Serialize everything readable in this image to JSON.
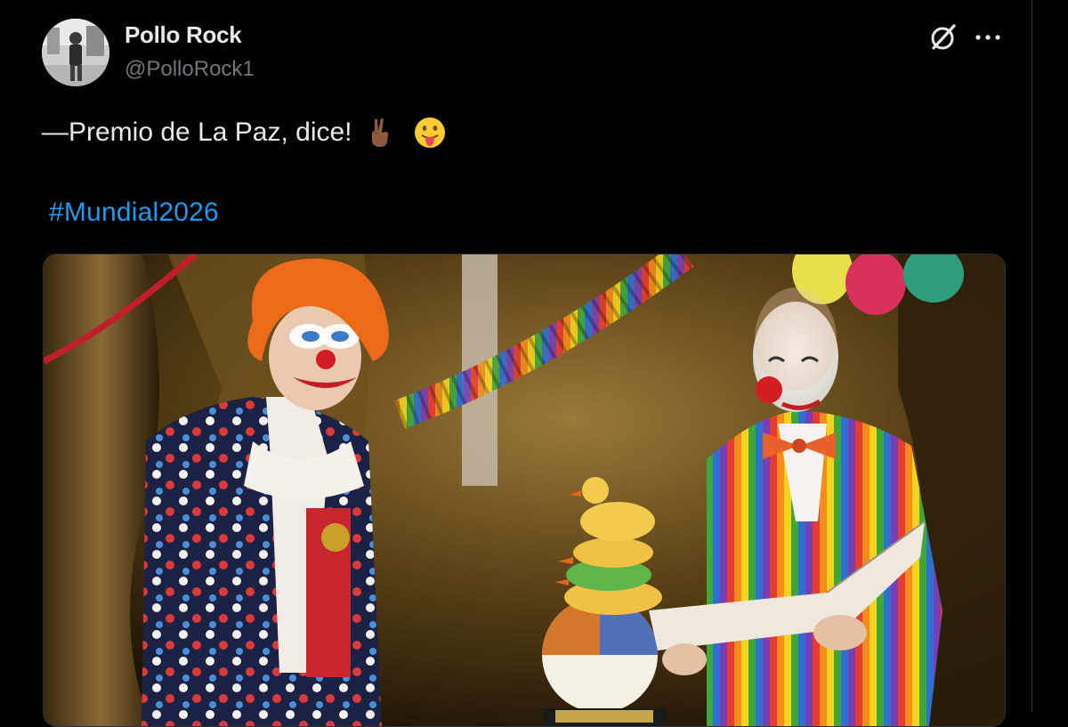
{
  "tweet": {
    "author": {
      "display_name": "Pollo Rock",
      "handle": "@PolloRock1",
      "avatar": "profile-photo"
    },
    "text": "—Premio de La Paz, dice!",
    "emojis": [
      "victory-hand-medium-dark-skin",
      "face-with-tongue"
    ],
    "hashtag": "#Mundial2026",
    "header_icons": [
      "grok-icon",
      "more-icon"
    ],
    "media": {
      "type": "photo",
      "subject": "two clowns on stage with a duck trophy and beach ball"
    }
  },
  "colors": {
    "background": "#000000",
    "text": "#e7e9ea",
    "secondary": "#71767b",
    "link": "#1d9bf0"
  }
}
